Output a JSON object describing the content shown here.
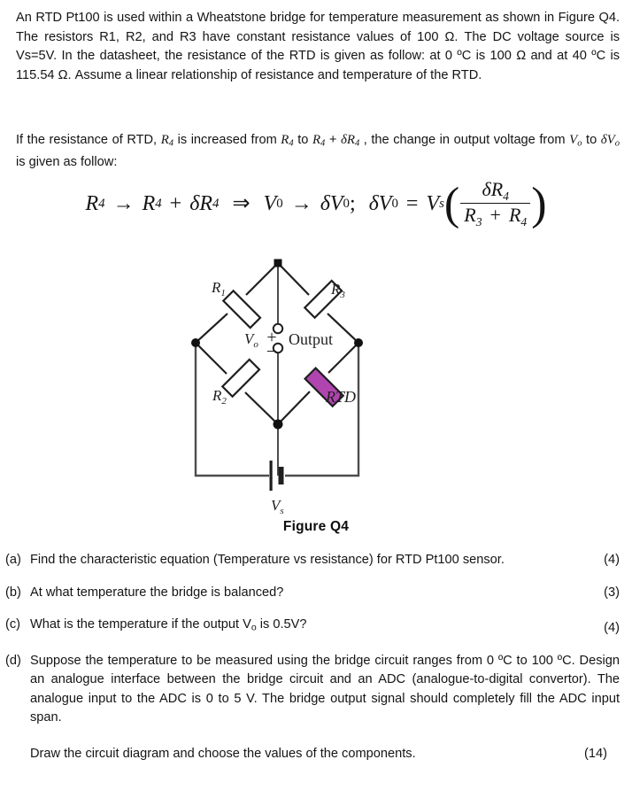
{
  "document": {
    "intro_paragraph": "An RTD Pt100 is used within a Wheatstone bridge for temperature measurement as shown in Figure Q4. The resistors R1, R2, and R3 have constant resistance values of 100 Ω. The DC voltage source is Vs=5V. In the datasheet, the resistance of the RTD is given as follow: at 0 ºC is 100 Ω and at 40 ºC is 115.54 Ω. Assume a linear relationship of resistance and temperature of the RTD.",
    "change_paragraph": {
      "seg1": "If the resistance of RTD, ",
      "sym_r4_a": "R",
      "sub_4_a": "4",
      "seg2": " is increased from ",
      "sym_r4_b": "R",
      "sub_4_b": "4",
      "seg3": " to ",
      "sym_r4_c": "R",
      "sub_4_c": "4",
      "seg4": " + ",
      "sym_dr4": "δR",
      "sub_4_d": "4",
      "seg5": " , the change in output voltage from ",
      "sym_vo_a": "V",
      "sub_o_a": "o",
      "seg6": " to ",
      "sym_dvo": "δV",
      "sub_o_b": "o",
      "seg7": " is given as follow:"
    },
    "equation": {
      "r": "R",
      "sub4": "4",
      "arrow": "→",
      "plus": "+",
      "delta_r": "δR",
      "implies": "⇒",
      "v": "V",
      "sub0": "0",
      "delta_v": "δV",
      "semicolon": ";",
      "equals": "=",
      "vs": "V",
      "sub_s": "s",
      "num_delta_r": "δR",
      "num_sub": "4",
      "den_r3": "R",
      "den_sub3": "3",
      "den_plus": "+",
      "den_r4": "R",
      "den_sub4": "4",
      "paren_open": "(",
      "paren_close": ")"
    }
  },
  "figure": {
    "caption": "Figure Q4",
    "labels": {
      "r1": "R",
      "r1_sub": "1",
      "r2": "R",
      "r2_sub": "2",
      "r3": "R",
      "r3_sub": "3",
      "rtd": "RTD",
      "vo": "V",
      "vo_sub": "o",
      "vs": "V",
      "vs_sub": "s",
      "output": "Output",
      "plus": "+",
      "minus": "–"
    },
    "colors": {
      "wire": "#4d4d4d",
      "component_stroke": "#1a1a1a",
      "rtd_fill": "#b145b0",
      "node_fill": "#111111"
    }
  },
  "questions": [
    {
      "label": "(a)",
      "text": "Find the characteristic equation (Temperature vs resistance) for RTD Pt100 sensor.",
      "marks": "(4)"
    },
    {
      "label": "(b)",
      "text": "At what temperature the bridge is balanced?",
      "marks": "(3)"
    },
    {
      "label": "(c)",
      "text_pre": "What is the temperature if the output V",
      "text_sub": "o",
      "text_post": " is 0.5V?",
      "marks": "(4)"
    },
    {
      "label": "(d)",
      "text": "Suppose the temperature to be measured using the bridge circuit ranges from 0 ºC to 100 ºC. Design an analogue interface between the bridge circuit and an ADC (analogue-to-digital convertor). The analogue input to the ADC is 0 to 5 V. The bridge output signal should completely fill the ADC input span.",
      "text2": "Draw the circuit diagram and choose the values of the components.",
      "marks": "(14)"
    }
  ]
}
